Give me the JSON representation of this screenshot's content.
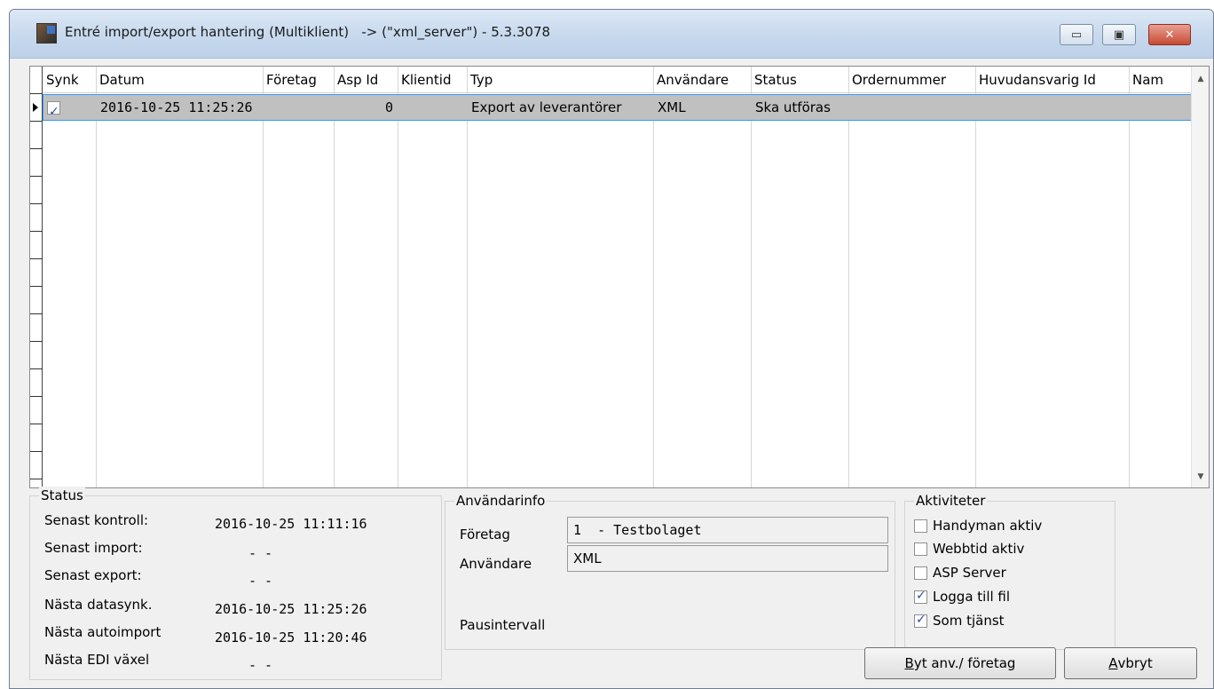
{
  "window": {
    "title": "Entré import/export hantering (Multiklient)   -> (\"xml_server\") - 5.3.3078",
    "min_glyph": "▭",
    "max_glyph": "▣",
    "close_glyph": "✕"
  },
  "grid": {
    "columns": [
      "Synk",
      "Datum",
      "Företag",
      "Asp Id",
      "Klientid",
      "Typ",
      "Användare",
      "Status",
      "Ordernummer",
      "Huvudansvarig Id",
      "Nam"
    ],
    "rows": [
      {
        "synk_checked": true,
        "datum": "2016-10-25 11:25:26",
        "foretag": "",
        "asp_id": "0",
        "klientid": "",
        "typ": "Export av leverantörer",
        "anvandare": "XML",
        "status": "Ska utföras",
        "ordernummer": "",
        "huvudansvarig_id": "",
        "nam": ""
      }
    ],
    "scroll_up": "▲",
    "scroll_down": "▼"
  },
  "status": {
    "title": "Status",
    "senast_kontroll_label": "Senast kontroll:",
    "senast_kontroll_value": "2016-10-25 11:11:16",
    "senast_import_label": "Senast import:",
    "senast_import_value": "- -",
    "senast_export_label": "Senast export:",
    "senast_export_value": "- -",
    "nasta_datasynk_label": "Nästa datasynk.",
    "nasta_datasynk_value": "2016-10-25 11:25:26",
    "nasta_autoimport_label": "Nästa autoimport",
    "nasta_autoimport_value": "2016-10-25 11:20:46",
    "nasta_edi_label": "Nästa EDI växel",
    "nasta_edi_value": "- -"
  },
  "anvandarinfo": {
    "title": "Användarinfo",
    "foretag_label": "Företag",
    "foretag_value": "1  - Testbolaget",
    "anvandare_label": "Användare",
    "anvandare_value": "XML",
    "pausintervall_label": "Pausintervall"
  },
  "aktiviteter": {
    "title": "Aktiviteter",
    "items": [
      {
        "label": "Handyman aktiv",
        "checked": false
      },
      {
        "label": "Webbtid aktiv",
        "checked": false
      },
      {
        "label": "ASP Server",
        "checked": false
      },
      {
        "label": "Logga till fil",
        "checked": true
      },
      {
        "label": "Som tjänst",
        "checked": true
      }
    ]
  },
  "buttons": {
    "byt_first": "B",
    "byt_rest": "yt anv./ företag",
    "avbryt_first": "A",
    "avbryt_rest": "vbryt"
  }
}
